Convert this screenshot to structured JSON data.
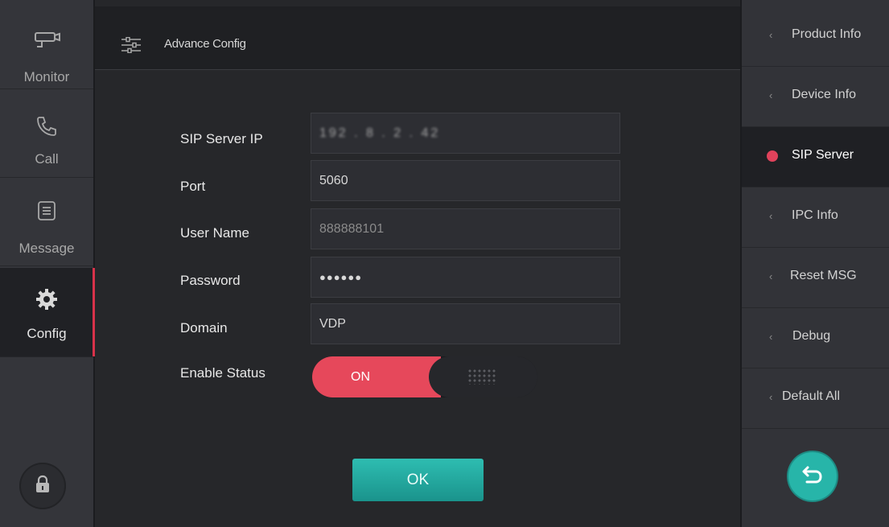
{
  "sidebar": {
    "items": [
      {
        "label": "Monitor",
        "icon": "camera-icon"
      },
      {
        "label": "Call",
        "icon": "phone-icon"
      },
      {
        "label": "Message",
        "icon": "message-icon"
      },
      {
        "label": "Config",
        "icon": "gear-icon"
      }
    ],
    "active": "Config",
    "lock_icon": "lock-icon"
  },
  "header": {
    "title": "Advance Config",
    "icon": "sliders-icon"
  },
  "form": {
    "sip_server_ip": {
      "label": "SIP Server IP",
      "value": "192 . 8 . 2 . 42"
    },
    "port": {
      "label": "Port",
      "value": "5060"
    },
    "user_name": {
      "label": "User Name",
      "value": "888888101"
    },
    "password": {
      "label": "Password",
      "value": "●●●●●●"
    },
    "domain": {
      "label": "Domain",
      "value": "VDP"
    },
    "enable_status": {
      "label": "Enable Status",
      "value": "ON"
    },
    "ok_label": "OK"
  },
  "rightmenu": {
    "items": [
      {
        "label": "Product Info"
      },
      {
        "label": "Device Info"
      },
      {
        "label": "SIP Server"
      },
      {
        "label": "IPC Info"
      },
      {
        "label": "Reset MSG"
      },
      {
        "label": "Debug"
      },
      {
        "label": "Default All"
      }
    ],
    "active": "SIP Server",
    "chevron": "‹",
    "back_icon": "back-icon"
  },
  "colors": {
    "accent": "#e6485b",
    "ok_button": "#2ebdb1",
    "background": "#26272a"
  }
}
